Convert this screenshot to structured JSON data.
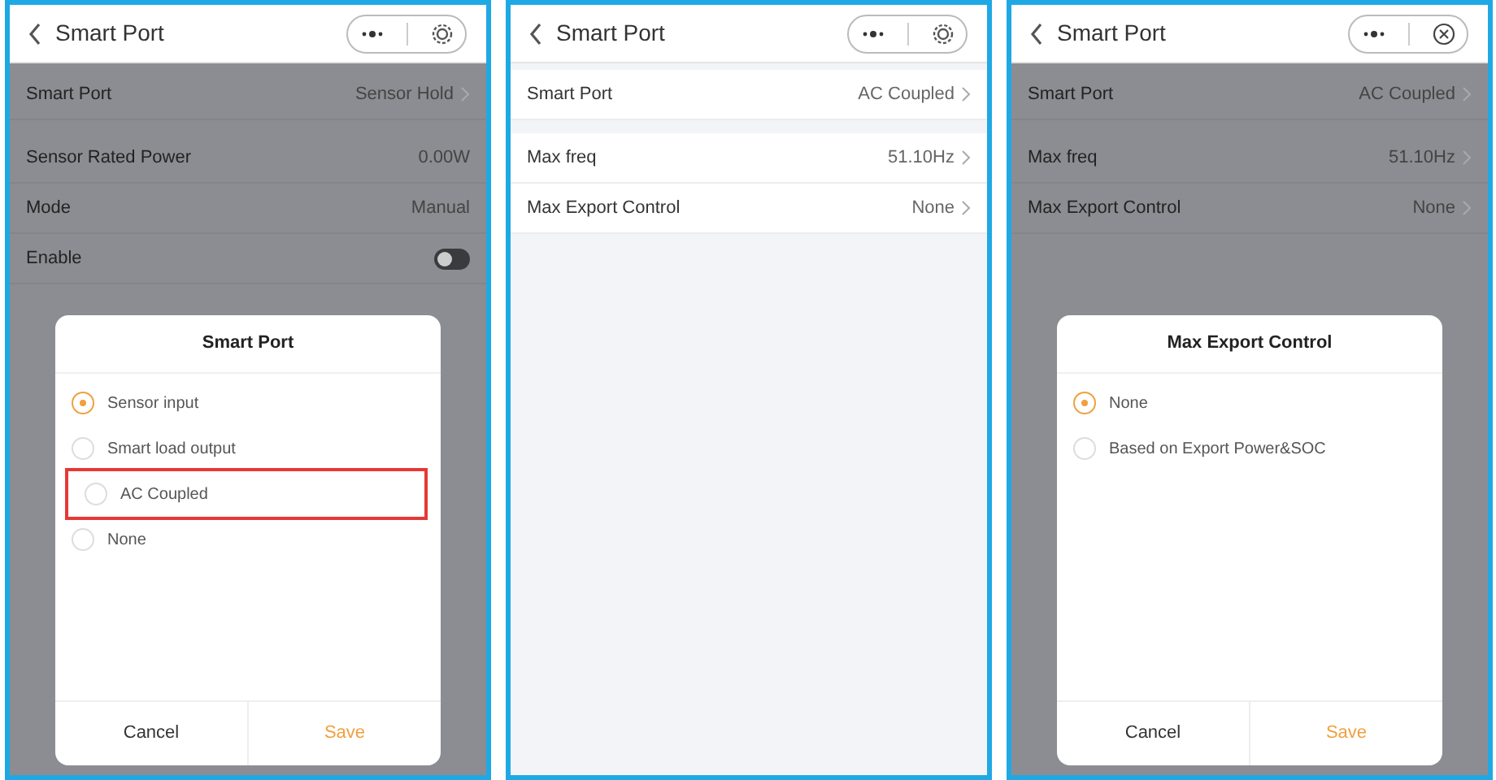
{
  "panels": [
    {
      "header": {
        "title": "Smart Port",
        "capsule": [
          {
            "kind": "more"
          },
          {
            "kind": "gear"
          }
        ]
      },
      "dimmed": true,
      "sections": [
        {
          "rows": [
            {
              "label": "Smart Port",
              "value": "Sensor Hold",
              "kind": "link"
            }
          ]
        },
        {
          "rows": [
            {
              "label": "Sensor Rated Power",
              "value": "0.00W",
              "kind": "value"
            },
            {
              "label": "Mode",
              "value": "Manual",
              "kind": "value"
            },
            {
              "label": "Enable",
              "kind": "toggle",
              "on": false
            }
          ]
        }
      ],
      "dialog": {
        "title": "Smart Port",
        "options": [
          {
            "label": "Sensor input",
            "selected": true,
            "highlighted": false
          },
          {
            "label": "Smart load output",
            "selected": false,
            "highlighted": false
          },
          {
            "label": "AC Coupled",
            "selected": false,
            "highlighted": true
          },
          {
            "label": "None",
            "selected": false,
            "highlighted": false
          }
        ],
        "buttons": [
          {
            "label": "Cancel",
            "kind": "cancel"
          },
          {
            "label": "Save",
            "kind": "save"
          }
        ]
      }
    },
    {
      "header": {
        "title": "Smart Port",
        "capsule": [
          {
            "kind": "more"
          },
          {
            "kind": "gear"
          }
        ]
      },
      "dimmed": false,
      "sections": [
        {
          "rows": [
            {
              "label": "Smart Port",
              "value": "AC Coupled",
              "kind": "link"
            }
          ]
        },
        {
          "rows": [
            {
              "label": "Max freq",
              "value": "51.10Hz",
              "kind": "link"
            },
            {
              "label": "Max Export Control",
              "value": "None",
              "kind": "link"
            }
          ]
        }
      ]
    },
    {
      "header": {
        "title": "Smart Port",
        "capsule": [
          {
            "kind": "more"
          },
          {
            "kind": "close"
          }
        ]
      },
      "dimmed": true,
      "sections": [
        {
          "rows": [
            {
              "label": "Smart Port",
              "value": "AC Coupled",
              "kind": "link"
            }
          ]
        },
        {
          "rows": [
            {
              "label": "Max freq",
              "value": "51.10Hz",
              "kind": "link"
            },
            {
              "label": "Max Export Control",
              "value": "None",
              "kind": "link"
            }
          ]
        }
      ],
      "dialog": {
        "title": "Max Export Control",
        "options": [
          {
            "label": "None",
            "selected": true,
            "highlighted": false
          },
          {
            "label": "Based on Export Power&SOC",
            "selected": false,
            "highlighted": false
          }
        ],
        "buttons": [
          {
            "label": "Cancel",
            "kind": "cancel"
          },
          {
            "label": "Save",
            "kind": "save"
          }
        ]
      }
    }
  ]
}
